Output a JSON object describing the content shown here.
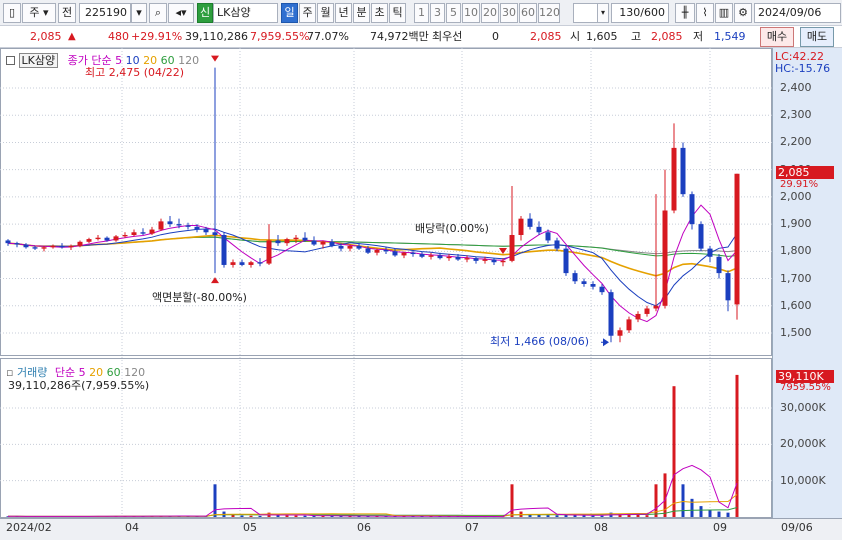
{
  "toolbar": {
    "market_select": "주",
    "prev_label": "전",
    "stock_code": "225190",
    "credit_badge": "신",
    "stock_name": "LK삼양",
    "periods": [
      "일",
      "주",
      "월",
      "년",
      "분",
      "초",
      "틱"
    ],
    "active_period": "일",
    "intervals": [
      "1",
      "3",
      "5",
      "10",
      "20",
      "30",
      "60",
      "120"
    ],
    "count_value": "130/600",
    "date_value": "2024/09/06"
  },
  "quote": {
    "price": "2,085",
    "change": "480",
    "change_rate": "+29.91%",
    "volume": "39,110,286",
    "volume_rate": "7,959.55%",
    "rate2": "77.07%",
    "amount": "74,972백만",
    "priority_label": "최우선",
    "priority_value": "0",
    "best_price": "2,085",
    "open_label": "시",
    "open": "1,605",
    "high_label": "고",
    "high": "2,085",
    "low_label": "저",
    "low": "1,549",
    "buy_label": "매수",
    "sell_label": "매도"
  },
  "price_pane": {
    "stock_label": "LK삼양",
    "ma_title": "종가 단순",
    "ma_periods": [
      "5",
      "10",
      "20",
      "60",
      "120"
    ],
    "lc_label": "LC:42.22",
    "hc_label": "HC:-15.76",
    "y_ticks": [
      "2,400",
      "2,300",
      "2,200",
      "2,100",
      "2,000",
      "1,900",
      "1,800",
      "1,700",
      "1,600",
      "1,500"
    ],
    "current_price_tag": "2,085",
    "current_rate_tag": "29.91%",
    "annotation_high": "최고 2,475 (04/22)",
    "annotation_split": "액면분할(-80.00%)",
    "annotation_dividend": "배당락(0.00%)",
    "annotation_low": "최저 1,466 (08/06)"
  },
  "volume_pane": {
    "title": "거래량",
    "ma_title": "단순",
    "ma_periods": [
      "5",
      "20",
      "60",
      "120"
    ],
    "current_volume": "39,110,286주(7,959.55%)",
    "y_ticks": [
      "30,000K",
      "20,000K",
      "10,000K"
    ],
    "current_volume_tag": "39,110K",
    "current_volume_rate_tag": "7959.55%"
  },
  "x_axis": {
    "labels": [
      "2024/02",
      "04",
      "05",
      "06",
      "07",
      "08",
      "09",
      "09/06"
    ]
  },
  "colors": {
    "up": "#d71920",
    "down": "#1b3fbf",
    "ma5": "#c000c0",
    "ma10": "#1b3fbf",
    "ma20": "#e5a100",
    "ma60": "#2e9e3e",
    "ma120": "#888888"
  },
  "chart_data": {
    "type": "candlestick",
    "price_ylim": [
      1400,
      2500
    ],
    "volume_ylim": [
      0,
      40000
    ],
    "candles_ohlc": [
      [
        1840,
        1845,
        1820,
        1830
      ],
      [
        1830,
        1835,
        1815,
        1825
      ],
      [
        1825,
        1830,
        1810,
        1815
      ],
      [
        1815,
        1820,
        1805,
        1810
      ],
      [
        1810,
        1820,
        1800,
        1815
      ],
      [
        1815,
        1825,
        1810,
        1820
      ],
      [
        1820,
        1830,
        1810,
        1815
      ],
      [
        1815,
        1825,
        1805,
        1820
      ],
      [
        1820,
        1840,
        1815,
        1835
      ],
      [
        1835,
        1850,
        1830,
        1845
      ],
      [
        1845,
        1860,
        1840,
        1850
      ],
      [
        1850,
        1855,
        1835,
        1840
      ],
      [
        1840,
        1860,
        1835,
        1855
      ],
      [
        1855,
        1870,
        1850,
        1860
      ],
      [
        1860,
        1880,
        1855,
        1870
      ],
      [
        1870,
        1885,
        1860,
        1865
      ],
      [
        1865,
        1890,
        1860,
        1880
      ],
      [
        1880,
        1920,
        1875,
        1910
      ],
      [
        1910,
        1930,
        1890,
        1900
      ],
      [
        1900,
        1920,
        1885,
        1895
      ],
      [
        1895,
        1905,
        1880,
        1890
      ],
      [
        1890,
        1900,
        1870,
        1880
      ],
      [
        1880,
        1890,
        1860,
        1870
      ],
      [
        1870,
        2475,
        1720,
        1860
      ],
      [
        1860,
        1870,
        1740,
        1750
      ],
      [
        1750,
        1770,
        1740,
        1760
      ],
      [
        1760,
        1770,
        1745,
        1750
      ],
      [
        1750,
        1765,
        1740,
        1760
      ],
      [
        1760,
        1775,
        1745,
        1755
      ],
      [
        1755,
        1900,
        1750,
        1840
      ],
      [
        1840,
        1860,
        1820,
        1830
      ],
      [
        1830,
        1850,
        1820,
        1845
      ],
      [
        1845,
        1860,
        1830,
        1850
      ],
      [
        1850,
        1870,
        1835,
        1840
      ],
      [
        1840,
        1855,
        1820,
        1825
      ],
      [
        1825,
        1840,
        1810,
        1835
      ],
      [
        1835,
        1845,
        1815,
        1820
      ],
      [
        1820,
        1830,
        1800,
        1810
      ],
      [
        1810,
        1825,
        1800,
        1820
      ],
      [
        1820,
        1830,
        1805,
        1810
      ],
      [
        1810,
        1820,
        1790,
        1795
      ],
      [
        1795,
        1810,
        1785,
        1805
      ],
      [
        1805,
        1815,
        1790,
        1800
      ],
      [
        1800,
        1810,
        1780,
        1785
      ],
      [
        1785,
        1800,
        1775,
        1795
      ],
      [
        1795,
        1805,
        1780,
        1790
      ],
      [
        1790,
        1800,
        1775,
        1780
      ],
      [
        1780,
        1795,
        1770,
        1785
      ],
      [
        1785,
        1795,
        1770,
        1775
      ],
      [
        1775,
        1790,
        1765,
        1780
      ],
      [
        1780,
        1790,
        1765,
        1770
      ],
      [
        1770,
        1785,
        1760,
        1775
      ],
      [
        1775,
        1780,
        1755,
        1765
      ],
      [
        1765,
        1780,
        1755,
        1770
      ],
      [
        1770,
        1775,
        1750,
        1760
      ],
      [
        1760,
        1775,
        1745,
        1765
      ],
      [
        1765,
        2040,
        1760,
        1860
      ],
      [
        1860,
        1930,
        1840,
        1920
      ],
      [
        1920,
        1940,
        1880,
        1890
      ],
      [
        1890,
        1910,
        1860,
        1870
      ],
      [
        1870,
        1880,
        1830,
        1840
      ],
      [
        1840,
        1850,
        1800,
        1810
      ],
      [
        1810,
        1820,
        1710,
        1720
      ],
      [
        1720,
        1730,
        1680,
        1690
      ],
      [
        1690,
        1700,
        1670,
        1680
      ],
      [
        1680,
        1690,
        1660,
        1670
      ],
      [
        1670,
        1680,
        1640,
        1650
      ],
      [
        1650,
        1660,
        1466,
        1490
      ],
      [
        1490,
        1520,
        1466,
        1510
      ],
      [
        1510,
        1560,
        1500,
        1550
      ],
      [
        1550,
        1580,
        1540,
        1570
      ],
      [
        1570,
        1600,
        1560,
        1590
      ],
      [
        1590,
        2010,
        1580,
        1600
      ],
      [
        1600,
        2100,
        1590,
        1950
      ],
      [
        1950,
        2270,
        1940,
        2180
      ],
      [
        2180,
        2200,
        2000,
        2010
      ],
      [
        2010,
        2020,
        1880,
        1900
      ],
      [
        1900,
        1910,
        1800,
        1810
      ],
      [
        1810,
        1820,
        1760,
        1780
      ],
      [
        1780,
        1790,
        1700,
        1720
      ],
      [
        1720,
        1730,
        1580,
        1620
      ],
      [
        1605,
        2085,
        1549,
        2085
      ]
    ],
    "volume_k": [
      200,
      180,
      150,
      160,
      170,
      150,
      140,
      160,
      200,
      220,
      210,
      190,
      230,
      250,
      240,
      220,
      260,
      300,
      280,
      250,
      230,
      210,
      200,
      9000,
      1500,
      600,
      400,
      350,
      300,
      1200,
      500,
      400,
      380,
      350,
      320,
      300,
      280,
      260,
      250,
      240,
      230,
      220,
      210,
      200,
      190,
      180,
      170,
      160,
      150,
      140,
      140,
      130,
      130,
      120,
      120,
      110,
      9000,
      1500,
      800,
      600,
      500,
      450,
      700,
      500,
      400,
      380,
      350,
      1200,
      900,
      700,
      600,
      500,
      9000,
      12000,
      36000,
      9000,
      5000,
      3000,
      2000,
      1500,
      1200,
      39110
    ],
    "moving_averages": {
      "5": "magenta",
      "10": "blue",
      "20": "orange",
      "60": "green",
      "120": "gray"
    },
    "annotations": [
      "최고 2,475 (04/22)",
      "액면분할(-80.00%)",
      "배당락(0.00%)",
      "최저 1,466 (08/06)"
    ]
  }
}
